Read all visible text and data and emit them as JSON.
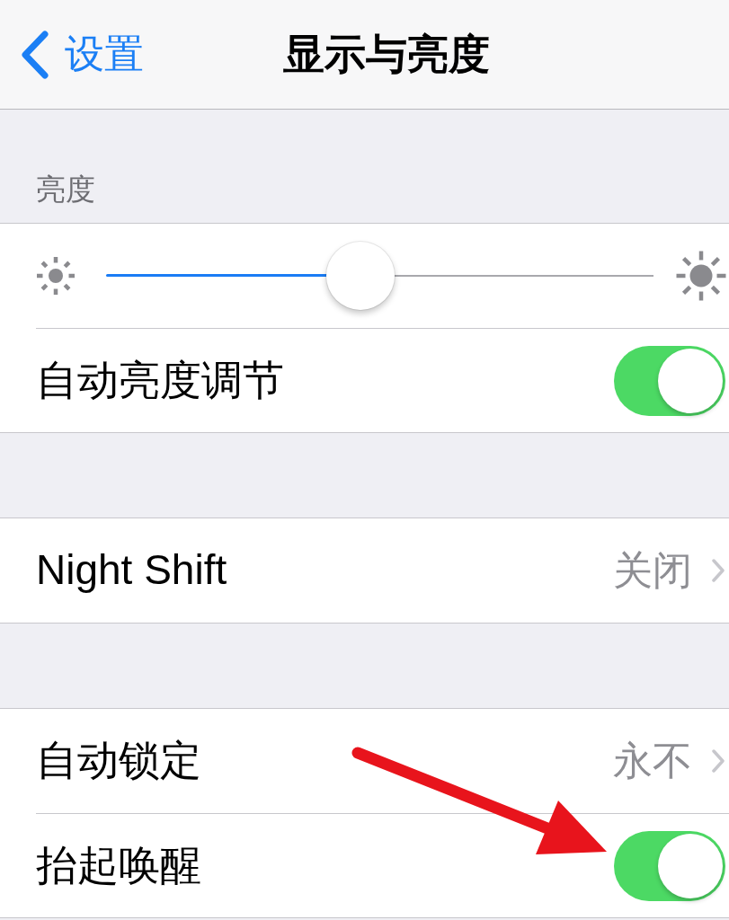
{
  "nav_bar": {
    "back_label": "设置",
    "title": "显示与亮度"
  },
  "sections": [
    {
      "header": "亮度",
      "rows": [
        {
          "kind": "slider",
          "level": 0.46
        },
        {
          "kind": "toggle",
          "label": "自动亮度调节",
          "on": true
        }
      ]
    },
    {
      "rows": [
        {
          "kind": "disclosure",
          "label": "Night Shift",
          "value": "关闭"
        }
      ]
    },
    {
      "rows": [
        {
          "kind": "disclosure",
          "label": "自动锁定",
          "value": "永不"
        },
        {
          "kind": "toggle",
          "label": "抬起唤醒",
          "on": true
        }
      ]
    }
  ],
  "annotation": {
    "kind": "arrow"
  }
}
